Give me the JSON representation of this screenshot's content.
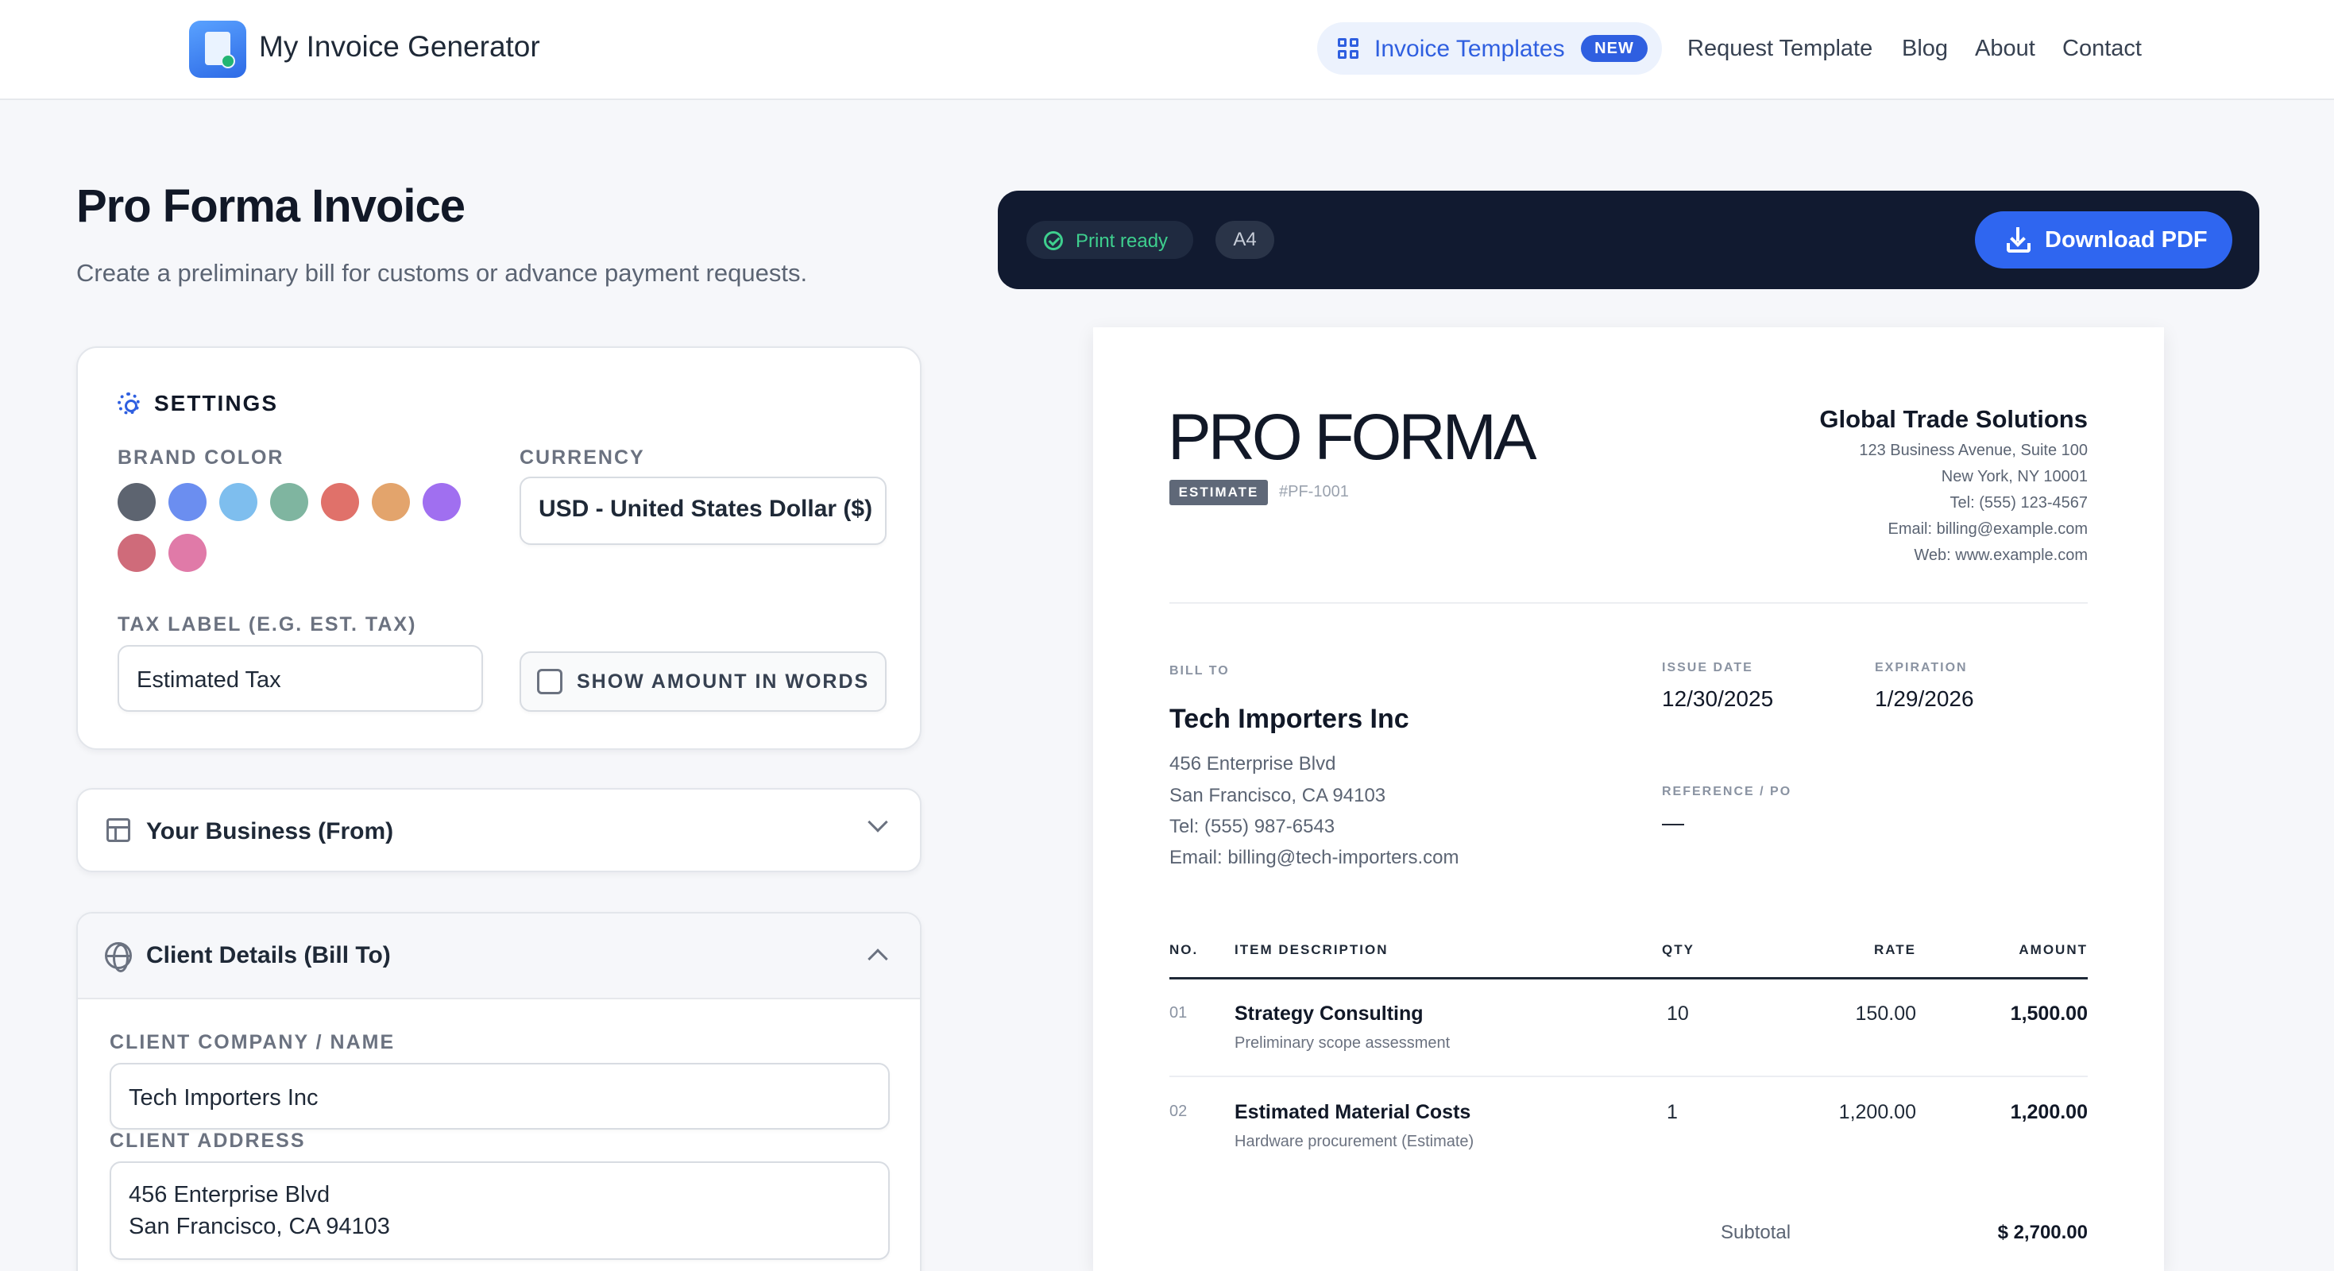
{
  "nav": {
    "brand": "My Invoice Generator",
    "templates_label": "Invoice Templates",
    "new_badge": "NEW",
    "links": [
      "Request Template",
      "Blog",
      "About",
      "Contact"
    ]
  },
  "page": {
    "title": "Pro Forma Invoice",
    "subtitle": "Create a preliminary bill for customs or advance payment requests."
  },
  "settings": {
    "title": "SETTINGS",
    "brand_color_label": "BRAND COLOR",
    "brand_colors": [
      "#5d6470",
      "#6b8ef0",
      "#7ebeee",
      "#7fb5a0",
      "#e0716a",
      "#e3a46c",
      "#a06ff0",
      "#cf6b7a",
      "#e07aa8"
    ],
    "currency_label": "CURRENCY",
    "currency_value": "USD - United States Dollar ($)",
    "tax_label_label": "TAX LABEL (E.G. EST. TAX)",
    "tax_label_value": "Estimated Tax",
    "show_words_label": "SHOW AMOUNT IN WORDS",
    "show_words_checked": false
  },
  "sections": {
    "business": "Your Business (From)",
    "client": "Client Details (Bill To)"
  },
  "client_form": {
    "name_label": "CLIENT COMPANY / NAME",
    "name_value": "Tech Importers Inc",
    "address_label": "CLIENT ADDRESS",
    "address_line1": "456 Enterprise Blvd",
    "address_line2": "San Francisco, CA 94103"
  },
  "toolbar": {
    "print_ready": "Print ready",
    "paper_size": "A4",
    "download": "Download PDF"
  },
  "invoice": {
    "heading": "PRO FORMA",
    "badge": "ESTIMATE",
    "number": "#PF-1001",
    "from": {
      "company": "Global Trade Solutions",
      "line1": "123 Business Avenue, Suite 100",
      "line2": "New York, NY 10001",
      "tel": "Tel: (555) 123-4567",
      "email": "Email: billing@example.com",
      "web": "Web: www.example.com"
    },
    "bill_to_label": "BILL TO",
    "client": {
      "company": "Tech Importers Inc",
      "line1": "456 Enterprise Blvd",
      "line2": "San Francisco, CA 94103",
      "tel": "Tel: (555) 987-6543",
      "email": "Email: billing@tech-importers.com"
    },
    "issue_date_label": "ISSUE DATE",
    "issue_date": "12/30/2025",
    "expiration_label": "EXPIRATION",
    "expiration": "1/29/2026",
    "reference_label": "REFERENCE / PO",
    "reference": "—",
    "columns": [
      "NO.",
      "ITEM DESCRIPTION",
      "QTY",
      "RATE",
      "AMOUNT"
    ],
    "items": [
      {
        "no": "01",
        "name": "Strategy Consulting",
        "desc": "Preliminary scope assessment",
        "qty": "10",
        "rate": "150.00",
        "amount": "1,500.00"
      },
      {
        "no": "02",
        "name": "Estimated Material Costs",
        "desc": "Hardware procurement (Estimate)",
        "qty": "1",
        "rate": "1,200.00",
        "amount": "1,200.00"
      }
    ],
    "subtotal_label": "Subtotal",
    "subtotal": "$ 2,700.00"
  }
}
